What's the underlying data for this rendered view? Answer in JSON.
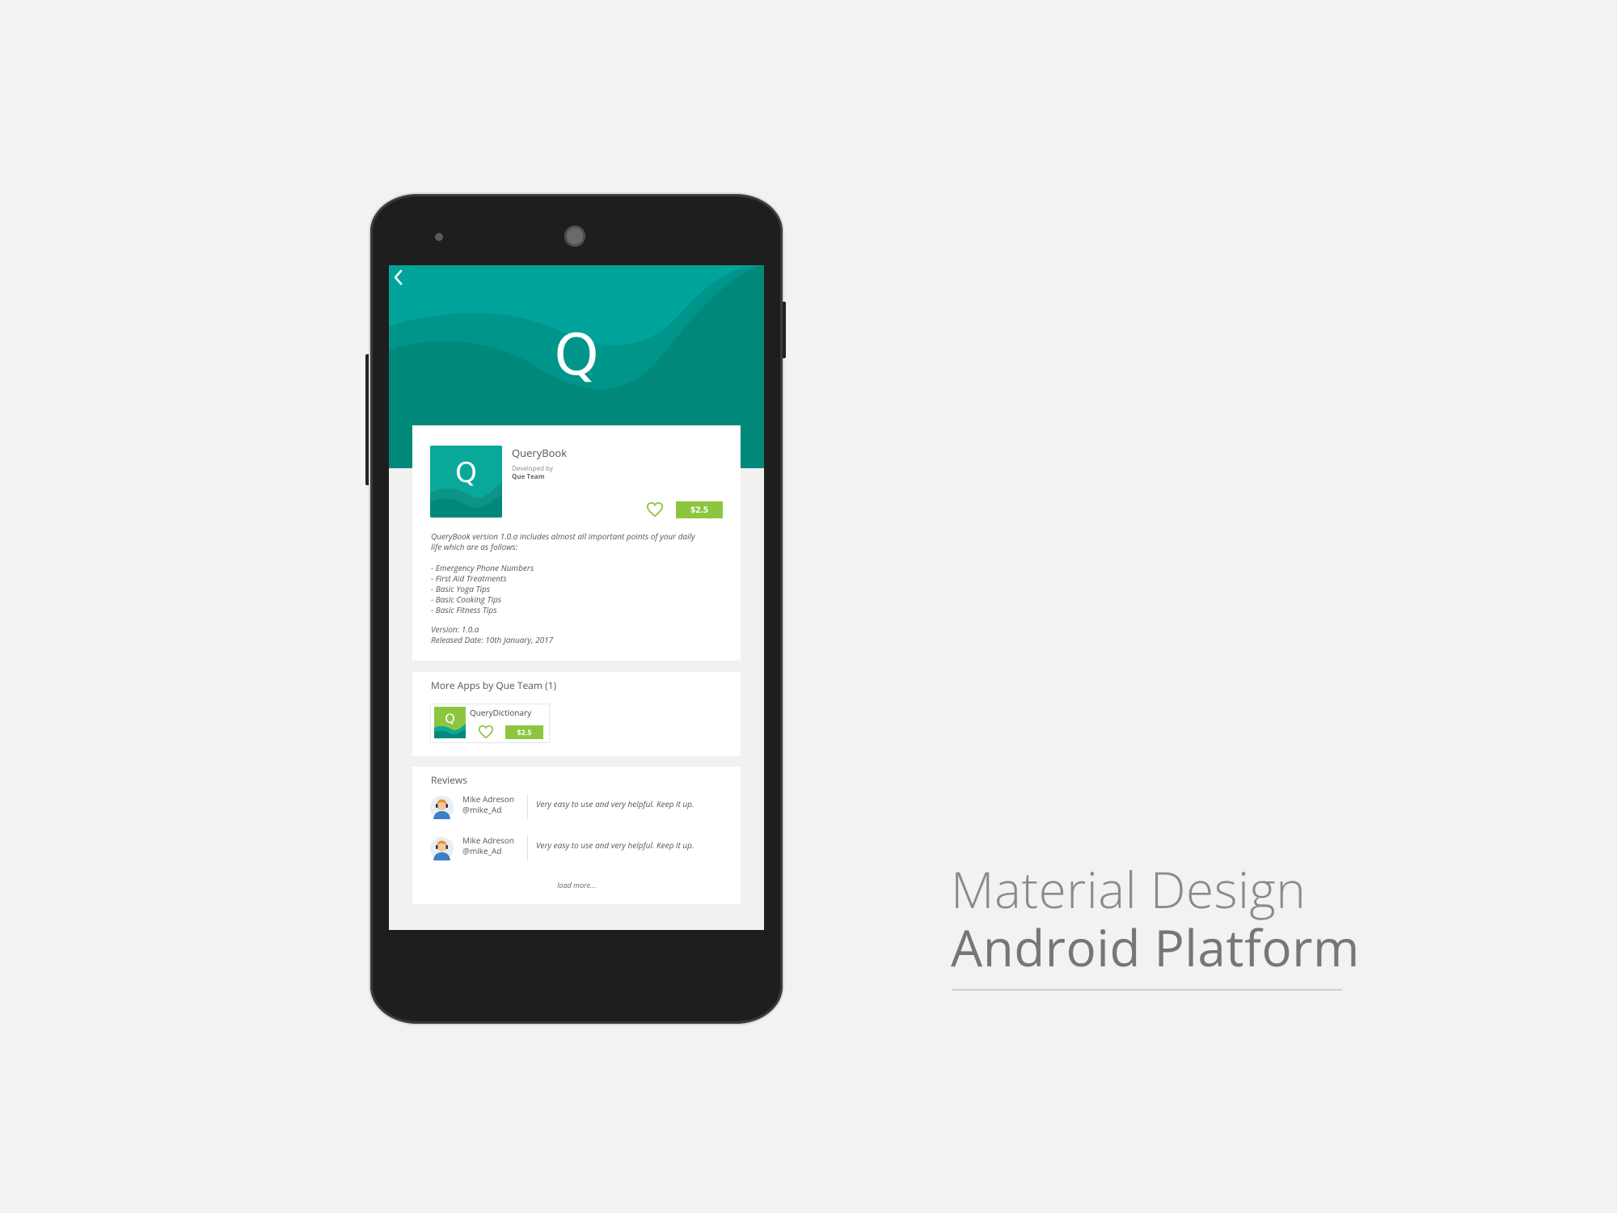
{
  "app": {
    "hero_letter": "Q",
    "icon_letter": "Q",
    "title": "QueryBook",
    "developed_by_label": "Developed by",
    "developer": "Que Team",
    "price": "$2.5",
    "description": {
      "intro_line1": "QueryBook version 1.0.a includes almost all important points of  your daily",
      "intro_line2": "life which are as follows:",
      "features": [
        "- Emergency Phone Numbers",
        "- First Aid Treatments",
        "- Basic Yoga Tips",
        "- Basic Cooking Tips",
        "- Basic Fitness Tips"
      ],
      "version": "Version: 1.0.a",
      "released": "Released Date: 10th January, 2017"
    }
  },
  "more_apps": {
    "title": "More Apps by Que Team (1)",
    "items": [
      {
        "name": "QueryDictionary",
        "icon_letter": "Q",
        "price": "$2.5"
      }
    ]
  },
  "reviews": {
    "title": "Reviews",
    "items": [
      {
        "name": "Mike Adreson",
        "handle": "@mike_Ad",
        "text": "Very easy to use and very helpful. Keep it up."
      },
      {
        "name": "Mike Adreson",
        "handle": "@mike_Ad",
        "text": "Very easy to use and very helpful. Keep it up."
      }
    ],
    "load_more": "load more..."
  },
  "promo": {
    "line1": "Material Design",
    "line2": "Android Platform"
  },
  "colors": {
    "teal": "#00a49a",
    "teal_dark": "#00897b",
    "green": "#8cc63f",
    "background": "#f2f2f2"
  },
  "icons": {
    "back": "chevron-left-icon",
    "favorite": "heart-outline-icon",
    "avatar": "user-avatar-icon"
  }
}
